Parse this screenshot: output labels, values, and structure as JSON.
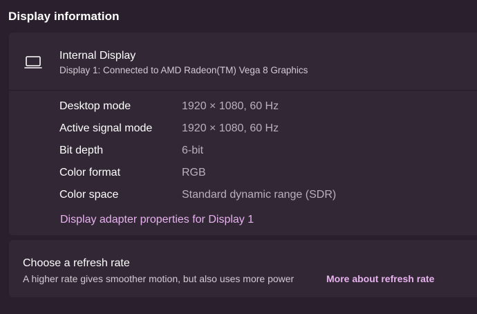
{
  "section": {
    "title": "Display information"
  },
  "display": {
    "icon": "laptop-icon",
    "name": "Internal Display",
    "subtitle": "Display 1: Connected to AMD Radeon(TM) Vega 8 Graphics",
    "properties": [
      {
        "label": "Desktop mode",
        "value": "1920 × 1080, 60 Hz"
      },
      {
        "label": "Active signal mode",
        "value": "1920 × 1080, 60 Hz"
      },
      {
        "label": "Bit depth",
        "value": "6-bit"
      },
      {
        "label": "Color format",
        "value": "RGB"
      },
      {
        "label": "Color space",
        "value": "Standard dynamic range (SDR)"
      }
    ],
    "adapter_link": "Display adapter properties for Display 1"
  },
  "refresh": {
    "title": "Choose a refresh rate",
    "description": "A higher rate gives smoother motion, but also uses more power",
    "link": "More about refresh rate"
  },
  "colors": {
    "background": "#2a1f2c",
    "card": "#322735",
    "accent_link": "#e7b2ee",
    "secondary_text": "#b9b1bb"
  }
}
